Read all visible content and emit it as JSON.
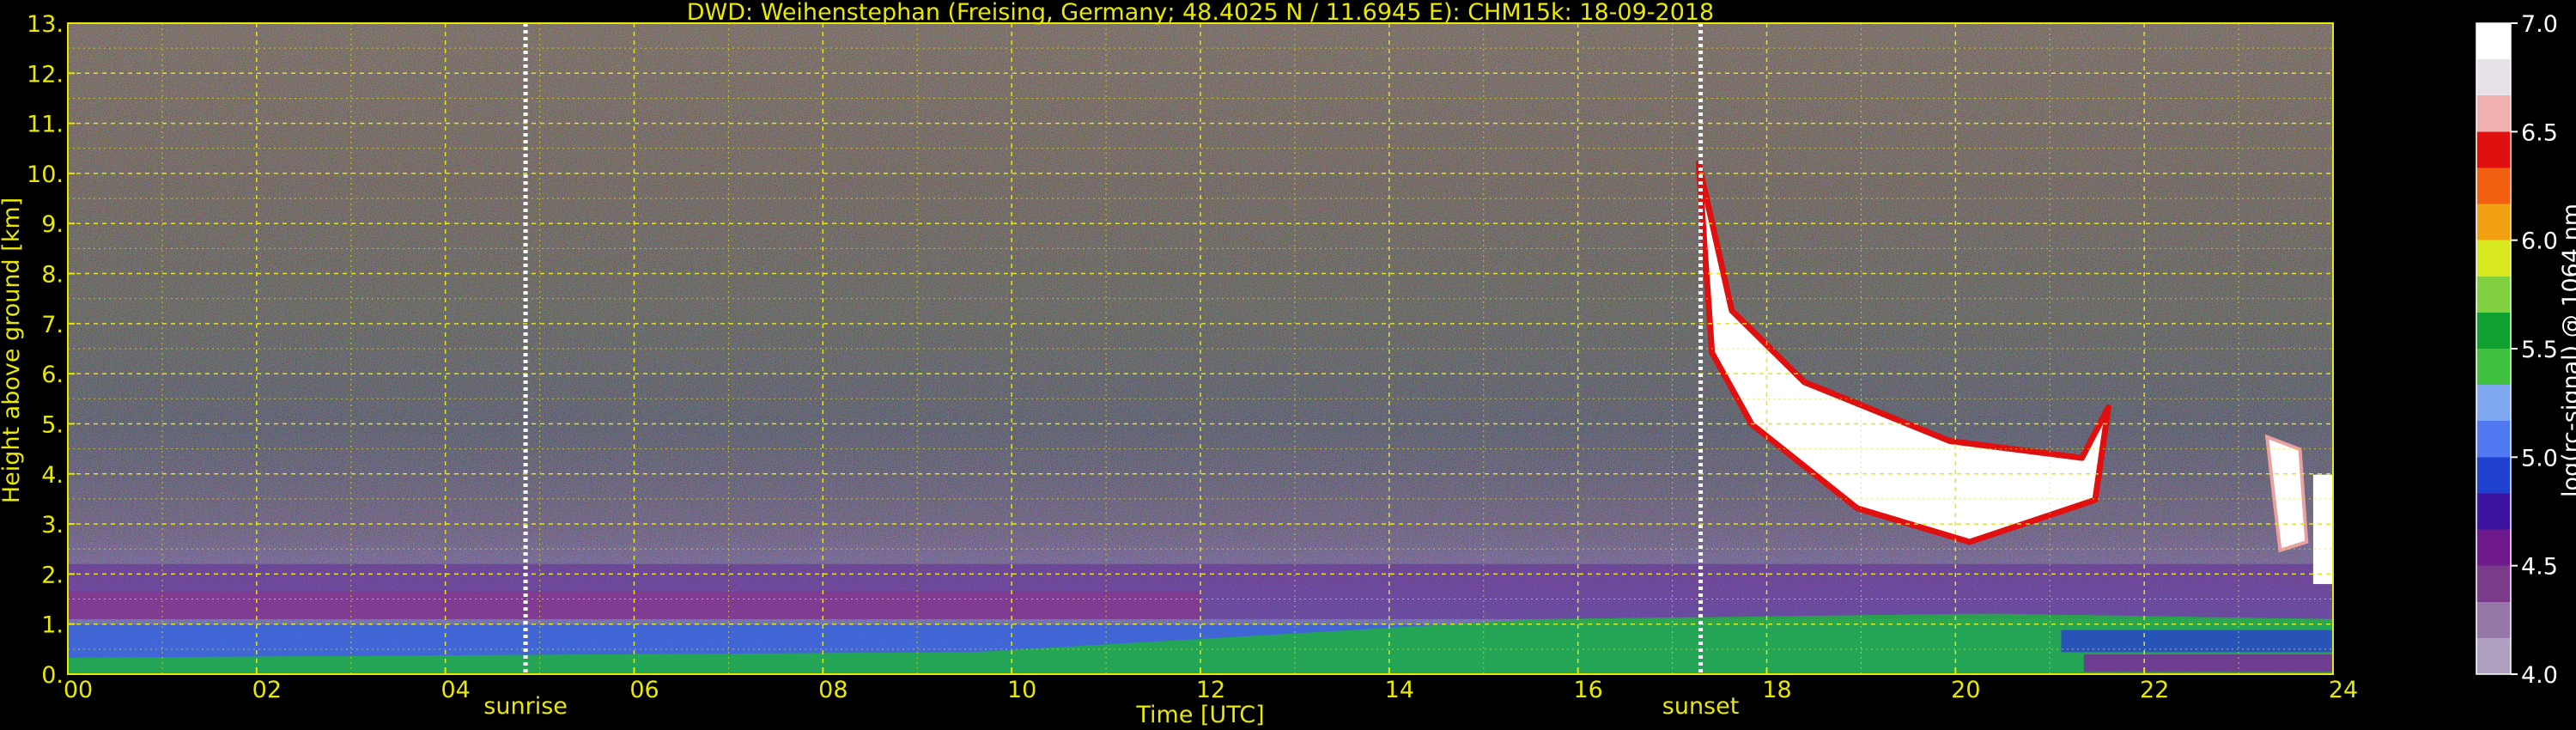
{
  "chart_data": {
    "type": "heatmap",
    "title": "DWD: Weihenstephan (Freising, Germany; 48.4025 N / 11.6945 E):    CHM15k: 18-09-2018",
    "xlabel": "Time [UTC]",
    "ylabel": "Height above ground [km]",
    "xlim": [
      0,
      24
    ],
    "ylim": [
      0,
      13
    ],
    "x_ticks": [
      "00",
      "02",
      "04",
      "06",
      "08",
      "10",
      "12",
      "14",
      "16",
      "18",
      "20",
      "22",
      "24"
    ],
    "y_ticks": [
      "0.",
      "1.",
      "2.",
      "3.",
      "4.",
      "5.",
      "6.",
      "7.",
      "8.",
      "9.",
      "10.",
      "11.",
      "12.",
      "13."
    ],
    "grid": true,
    "annotations": [
      {
        "label": "sunrise",
        "x": 4.85
      },
      {
        "label": "sunset",
        "x": 17.3
      }
    ],
    "colorbar": {
      "label": "log(rc-signal) @ 1064 nm",
      "range": [
        4.0,
        7.0
      ],
      "ticks": [
        "4.0",
        "4.5",
        "5.0",
        "5.5",
        "6.0",
        "6.5",
        "7.0"
      ],
      "colors": [
        "#b0a0c0",
        "#9878a8",
        "#7a3c8a",
        "#6e1a8c",
        "#3c14a0",
        "#2040d0",
        "#5078f0",
        "#80a8f0",
        "#40c040",
        "#10a030",
        "#80d040",
        "#d8e820",
        "#f0a010",
        "#f06010",
        "#e01010",
        "#f0b0b0",
        "#e8e0e8",
        "#ffffff"
      ]
    },
    "features": [
      {
        "name": "aerosol-layer",
        "x": [
          0,
          24
        ],
        "y": [
          0,
          2.2
        ]
      },
      {
        "name": "cloud-layer",
        "x": [
          17.0,
          24.0
        ],
        "y": [
          1.8,
          10.2
        ]
      }
    ]
  }
}
